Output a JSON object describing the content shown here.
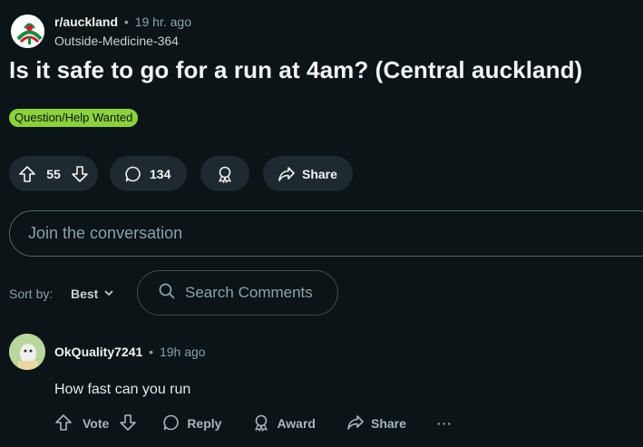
{
  "post": {
    "subreddit": "r/auckland",
    "separator": "•",
    "time_ago": "19 hr. ago",
    "author": "Outside-Medicine-364",
    "title": "Is it safe to go for a run at 4am? (Central auckland)",
    "flair": "Question/Help Wanted",
    "flair_color": "#8bd13c"
  },
  "actions": {
    "vote_count": "55",
    "comment_count": "134",
    "share_label": "Share"
  },
  "composer": {
    "placeholder": "Join the conversation"
  },
  "sort": {
    "label": "Sort by:",
    "selected": "Best"
  },
  "search": {
    "placeholder": "Search Comments"
  },
  "comment": {
    "username": "OkQuality7241",
    "separator": "•",
    "time_ago": "19h ago",
    "body": "How fast can you run",
    "actions": {
      "vote": "Vote",
      "reply": "Reply",
      "award": "Award",
      "share": "Share",
      "more": "···"
    }
  },
  "colors": {
    "background": "#0b1416",
    "pill": "#1e2a2f",
    "muted_text": "#8ba2ad"
  },
  "icons": [
    "subreddit-logo-icon",
    "upvote-icon",
    "downvote-icon",
    "comment-icon",
    "award-icon",
    "share-icon",
    "chevron-down-icon",
    "search-icon",
    "user-avatar-icon",
    "more-icon"
  ]
}
